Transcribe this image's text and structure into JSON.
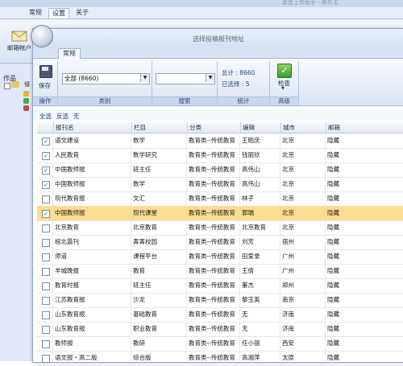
{
  "background": {
    "window_title": "康晋上传助手 - 邮件主",
    "tabs": [
      "常规",
      "设置",
      "关于"
    ],
    "mail_button_label": "邮箱帐户",
    "works_label": "作品",
    "tree_label": "侵"
  },
  "dialog": {
    "title": "选择投稿报刊地址",
    "tab": "常规",
    "save_label": "保存",
    "groups": {
      "operation": "操作",
      "category": "类别",
      "search": "搜索",
      "stats": "统计",
      "advanced": "高级"
    },
    "category_select": "全部 (8660)",
    "search_select": "",
    "total": "总计 : 8660",
    "selected": "已选择 : 5",
    "check_label": "检查",
    "filters": {
      "all": "全选",
      "invert": "反选",
      "none": "无"
    }
  },
  "table": {
    "headers": [
      "报刊名",
      "栏目",
      "分类",
      "编辑",
      "城市",
      "邮箱"
    ],
    "rows": [
      {
        "checked": true,
        "name": "语文建设",
        "column": "数学",
        "category": "教育类--传统教育",
        "editor": "王昭庆",
        "city": "北京",
        "email": "隐藏"
      },
      {
        "checked": true,
        "name": "人民教育",
        "column": "数学研究",
        "category": "教育类--传统教育",
        "editor": "钱丽欣",
        "city": "北京",
        "email": "隐藏"
      },
      {
        "checked": true,
        "name": "中国教师报",
        "column": "班主任",
        "category": "教育类--传统教育",
        "editor": "高伟山",
        "city": "北京",
        "email": "隐藏"
      },
      {
        "checked": true,
        "name": "中国教师报",
        "column": "数学",
        "category": "教育类--传统教育",
        "editor": "高伟山",
        "city": "北京",
        "email": "隐藏"
      },
      {
        "checked": false,
        "name": "现代教育报",
        "column": "文汇",
        "category": "教育类--传统教育",
        "editor": "林子",
        "city": "北京",
        "email": "隐藏"
      },
      {
        "checked": true,
        "name": "中国教师报",
        "column": "现代课堂",
        "category": "教育类--传统教育",
        "editor": "郭瑞",
        "city": "北京",
        "email": "隐藏",
        "selected": true
      },
      {
        "checked": false,
        "name": "北京教育",
        "column": "北京教育",
        "category": "教育类--传统教育",
        "editor": "北京教育",
        "city": "北京",
        "email": "隐藏"
      },
      {
        "checked": false,
        "name": "皖北晨刊",
        "column": "菁菁校园",
        "category": "教育类--传统教育",
        "editor": "刘芳",
        "city": "宿州",
        "email": "隐藏"
      },
      {
        "checked": false,
        "name": "师道",
        "column": "课程平台",
        "category": "教育类--传统教育",
        "editor": "田爱录",
        "city": "广州",
        "email": "隐藏"
      },
      {
        "checked": false,
        "name": "羊城晚报",
        "column": "教育",
        "category": "教育类--传统教育",
        "editor": "王倩",
        "city": "广州",
        "email": "隐藏"
      },
      {
        "checked": false,
        "name": "教育时报",
        "column": "班主任",
        "category": "教育类--传统教育",
        "editor": "董杰",
        "city": "郑州",
        "email": "隐藏"
      },
      {
        "checked": false,
        "name": "江苏教育报",
        "column": "沙龙",
        "category": "教育类--传统教育",
        "editor": "黎玉英",
        "city": "南京",
        "email": "隐藏"
      },
      {
        "checked": false,
        "name": "山东教育报",
        "column": "基础教育",
        "category": "教育类--传统教育",
        "editor": "无",
        "city": "济南",
        "email": "隐藏"
      },
      {
        "checked": false,
        "name": "山东教育报",
        "column": "职业教育",
        "category": "教育类--传统教育",
        "editor": "无",
        "city": "济南",
        "email": "隐藏"
      },
      {
        "checked": false,
        "name": "教师报",
        "column": "教研",
        "category": "教育类--传统教育",
        "editor": "任小丽",
        "city": "西安",
        "email": "隐藏"
      },
      {
        "checked": false,
        "name": "语文报・高二版",
        "column": "综合版",
        "category": "教育类--传统教育",
        "editor": "高湘萍",
        "city": "太原",
        "email": "隐藏"
      }
    ]
  },
  "colors": {
    "selected_row": "#fcdc8e",
    "ribbon_blue": "#dbe6f4",
    "check_green": "#3a9b2a"
  }
}
